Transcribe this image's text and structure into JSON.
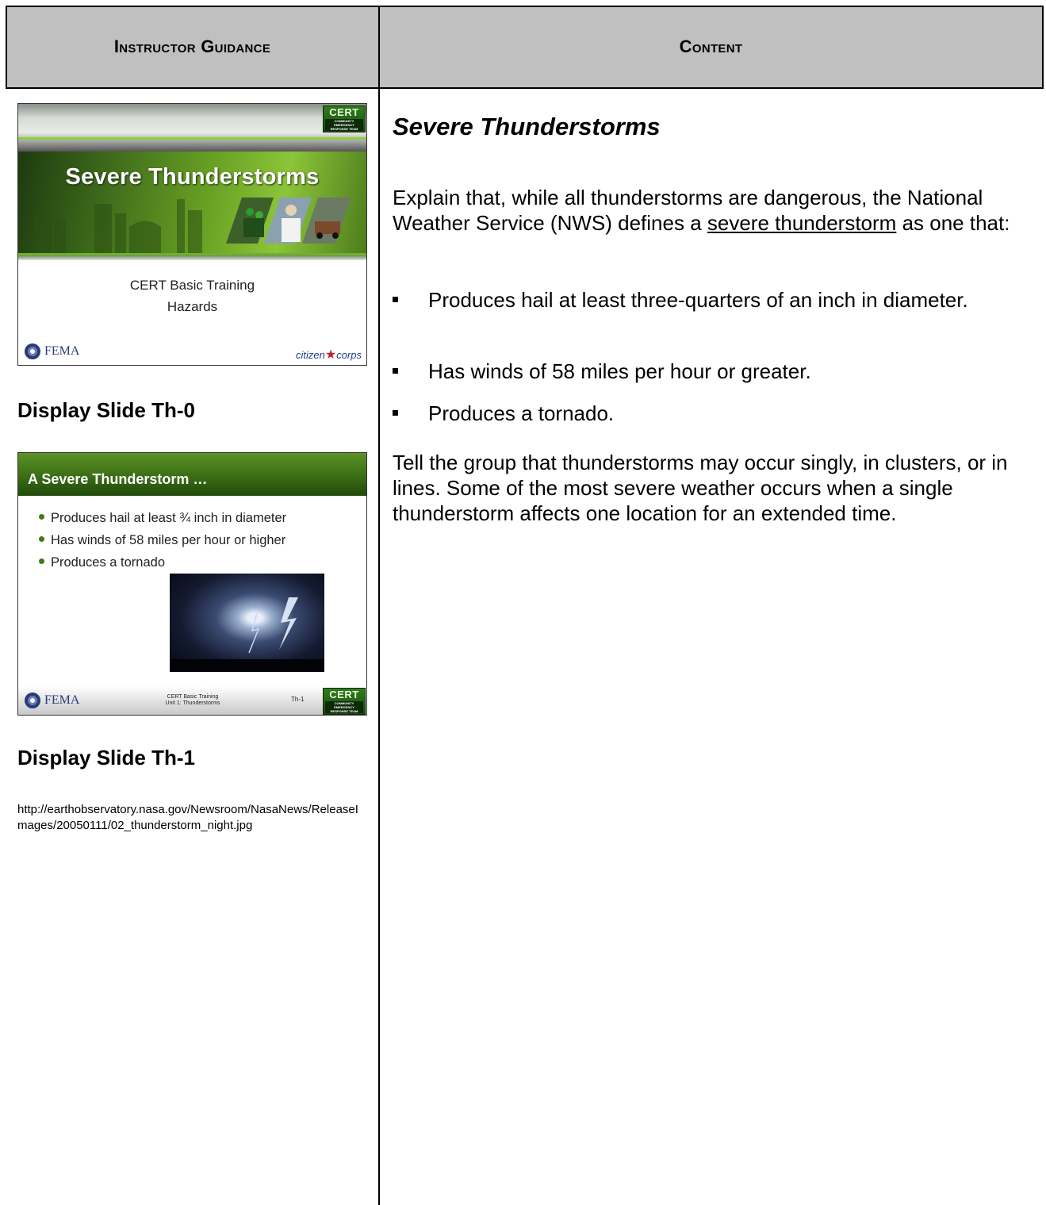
{
  "header": {
    "left": "Instructor Guidance",
    "right": "Content"
  },
  "slide0": {
    "title": "Severe Thunderstorms",
    "subtitle_line1": "CERT Basic Training",
    "subtitle_line2": "Hazards",
    "fema": "FEMA",
    "citizen_left": "citizen",
    "citizen_right": "corps",
    "cert_badge": "CERT",
    "cert_badge_small": "COMMUNITY EMERGENCY RESPONSE TEAM"
  },
  "slide0_label": "Display Slide Th-0",
  "slide1": {
    "title": "A Severe Thunderstorm …",
    "bullets": [
      "Produces hail at least ¾ inch in diameter",
      "Has winds of 58 miles per hour or higher",
      "Produces a tornado"
    ],
    "fema": "FEMA",
    "footer_line1": "CERT Basic Training",
    "footer_line2": "Unit 1: Thunderstorms",
    "slide_number": "Th-1",
    "cert_badge": "CERT",
    "cert_badge_small": "COMMUNITY EMERGENCY RESPONSE TEAM"
  },
  "slide1_label": "Display Slide Th-1",
  "source_url": "http://earthobservatory.nasa.gov/Newsroom/NasaNews/ReleaseImages/20050111/02_thunderstorm_night.jpg",
  "content": {
    "heading": "Severe Thunderstorms",
    "intro_before": "Explain that, while all thunderstorms are dangerous, the National Weather Service (NWS) defines a ",
    "intro_term": "severe thunderstorm",
    "intro_after": " as one that:",
    "bullets": [
      "Produces hail at least three-quarters of an inch in diameter.",
      "Has winds of 58 miles per hour or greater.",
      "Produces a tornado."
    ],
    "closing": "Tell the group that thunderstorms may occur singly, in clusters, or in lines. Some of the most severe weather occurs when a single thunderstorm affects one location for an extended time."
  }
}
